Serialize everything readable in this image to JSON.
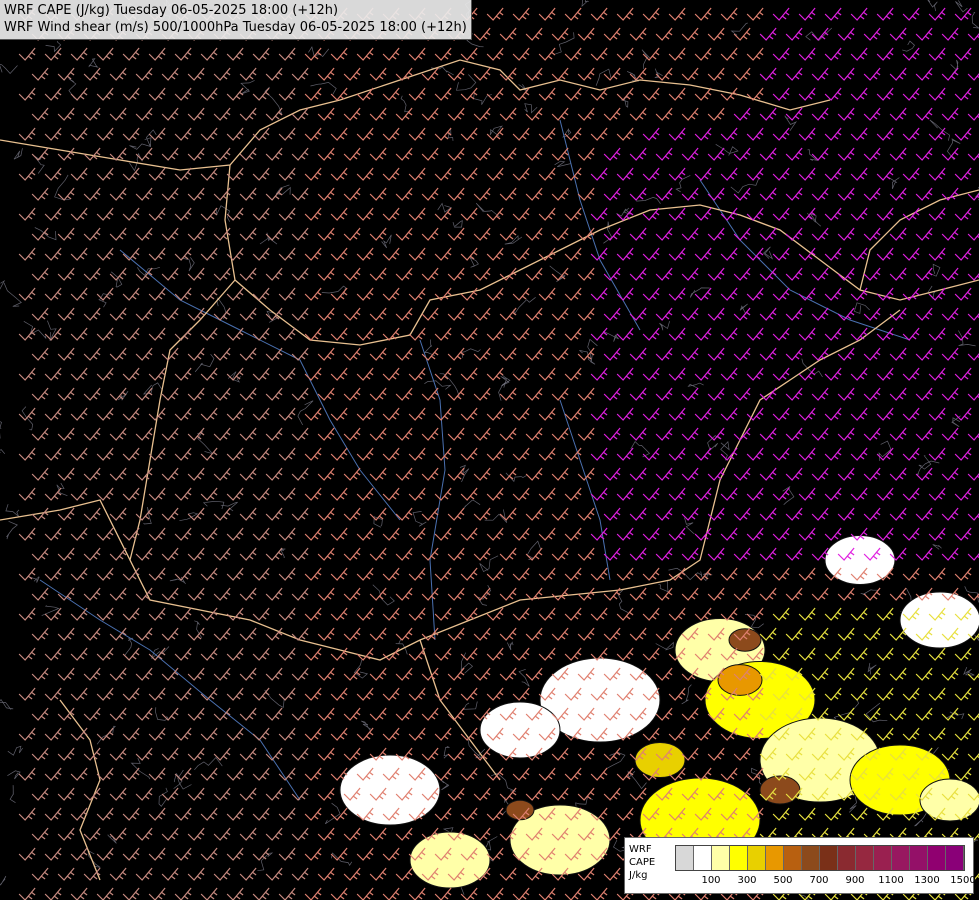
{
  "header": {
    "line1": "WRF CAPE (J/kg) Tuesday 06-05-2025 18:00 (+12h)",
    "line2": "WRF Wind shear (m/s) 500/1000hPa Tuesday 06-05-2025 18:00 (+12h)"
  },
  "legend": {
    "label_line1": "WRF",
    "label_line2": "CAPE",
    "label_line3": "J/kg",
    "colors": [
      "#d8d8d8",
      "#ffffff",
      "#ffffa8",
      "#ffff00",
      "#e8d000",
      "#e89800",
      "#b86010",
      "#8c4a1c",
      "#7a3018",
      "#8a2a30",
      "#962840",
      "#9a2050",
      "#981860",
      "#941068",
      "#900070",
      "#8a0078"
    ],
    "ticks": [
      "100",
      "300",
      "500",
      "700",
      "900",
      "1100",
      "1300",
      "1500"
    ]
  },
  "map_colors": {
    "background": "#000000",
    "barb_low_shear": "#c88a80",
    "barb_mid_shear": "#e08070",
    "barb_high_shear": "#e020e0",
    "barb_strong_south": "#e8e040",
    "country_border": "#e8c090",
    "river": "#4a70b0",
    "terrain_contour": "#8a8a9a",
    "cape_contour": "#111111"
  }
}
